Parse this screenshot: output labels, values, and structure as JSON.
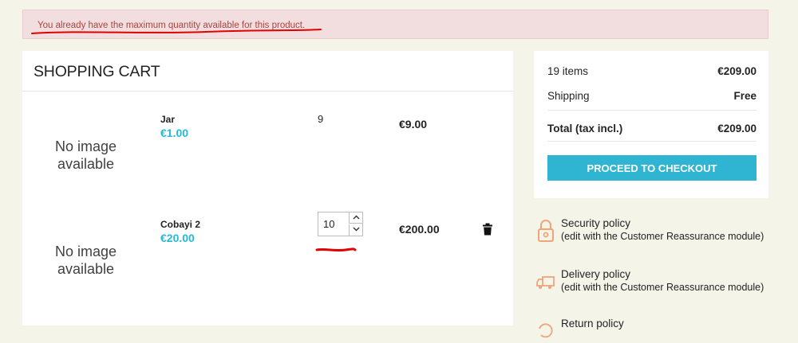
{
  "alert": {
    "message": "You already have the maximum quantity available for this product."
  },
  "cart": {
    "title": "SHOPPING CART",
    "items": [
      {
        "image_text_1": "No image",
        "image_text_2": "available",
        "name": "Jar",
        "unit_price": "€1.00",
        "quantity": "9",
        "total": "€9.00"
      },
      {
        "image_text_1": "No image",
        "image_text_2": "available",
        "name": "Cobayi 2",
        "unit_price": "€20.00",
        "quantity": "10",
        "total": "€200.00"
      }
    ]
  },
  "summary": {
    "items_label": "19 items",
    "items_value": "€209.00",
    "shipping_label": "Shipping",
    "shipping_value": "Free",
    "total_label": "Total (tax incl.)",
    "total_value": "€209.00",
    "checkout_label": "PROCEED TO CHECKOUT"
  },
  "reassurance": [
    {
      "title": "Security policy",
      "description": "(edit with the Customer Reassurance module)",
      "icon": "lock-icon"
    },
    {
      "title": "Delivery policy",
      "description": "(edit with the Customer Reassurance module)",
      "icon": "truck-icon"
    },
    {
      "title": "Return policy",
      "icon": "return-icon"
    }
  ],
  "colors": {
    "accent": "#2fb5d2",
    "price": "#24b9d7",
    "alert_bg": "#f2dede",
    "alert_text": "#a94442",
    "annotation": "#e00000"
  }
}
